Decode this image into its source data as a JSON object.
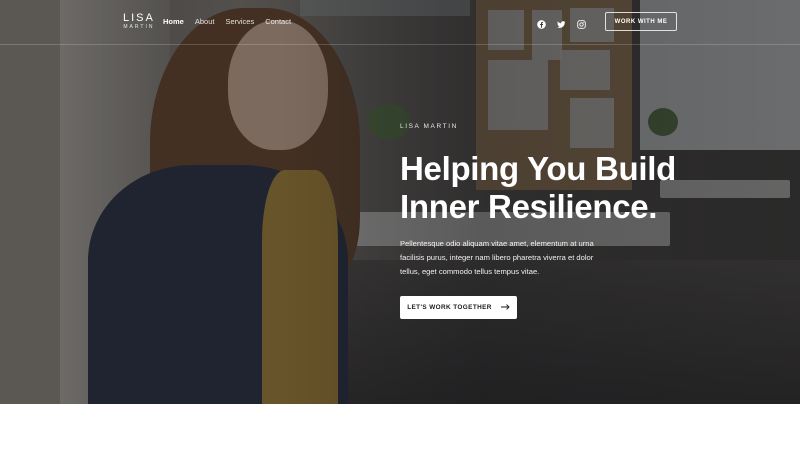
{
  "header": {
    "logo": {
      "name": "LISA",
      "sub": "MARTIN"
    },
    "nav": [
      {
        "label": "Home",
        "active": true
      },
      {
        "label": "About",
        "active": false
      },
      {
        "label": "Services",
        "active": false
      },
      {
        "label": "Contact",
        "active": false
      }
    ],
    "social_icons": [
      "facebook-icon",
      "twitter-icon",
      "instagram-icon"
    ],
    "cta_label": "WORK WITH ME"
  },
  "hero": {
    "eyebrow": "LISA MARTIN",
    "headline_line1": "Helping You Build",
    "headline_line2": "Inner Resilience.",
    "description_line1": "Pellentesque odio aliquam vitae amet, elementum at urna",
    "description_line2": "facilisis purus, integer nam libero pharetra viverra et dolor",
    "description_line3": "tellus, eget commodo tellus tempus vitae.",
    "cta_label": "LET'S WORK TOGETHER",
    "cta_icon": "arrow-right-icon"
  },
  "colors": {
    "text_on_dark": "#ffffff",
    "button_bg": "#ffffff",
    "button_text": "#1a1a1a",
    "page_bg": "#ffffff"
  }
}
